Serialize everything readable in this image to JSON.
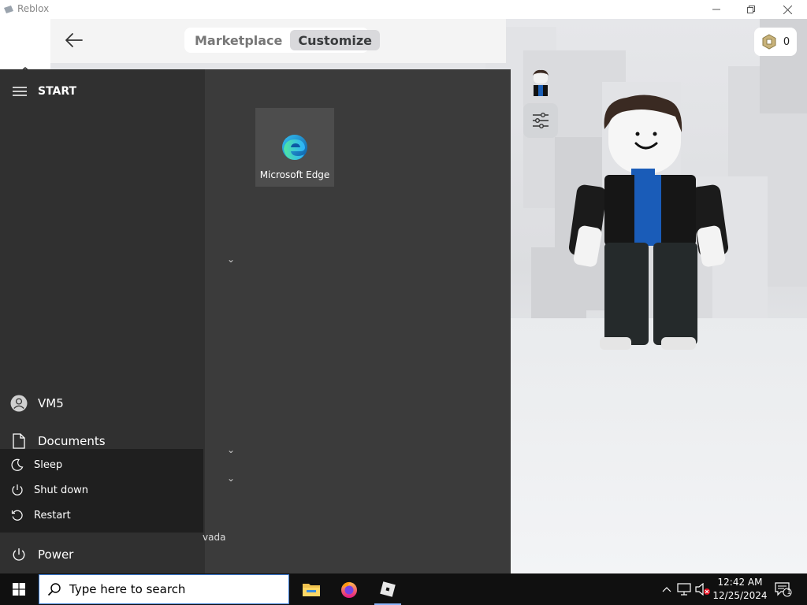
{
  "window": {
    "title": "Reblox"
  },
  "topbar": {
    "tabs": [
      {
        "label": "Marketplace",
        "active": false
      },
      {
        "label": "Customize",
        "active": true
      }
    ],
    "robux_count": "0"
  },
  "start_menu": {
    "header": "START",
    "side_items": [
      {
        "label": "VM5",
        "icon": "user-icon"
      },
      {
        "label": "Documents",
        "icon": "document-icon"
      }
    ],
    "power_options": [
      {
        "label": "Sleep",
        "icon": "moon-icon"
      },
      {
        "label": "Shut down",
        "icon": "power-icon"
      },
      {
        "label": "Restart",
        "icon": "restart-icon"
      }
    ],
    "power_label": "Power",
    "tile": {
      "label": "Microsoft Edge",
      "icon": "edge-icon"
    },
    "partial_text": "vada"
  },
  "taskbar": {
    "search_placeholder": "Type here to search",
    "apps": [
      "file-explorer-icon",
      "firefox-icon",
      "roblox-icon"
    ],
    "clock": {
      "time": "12:42 AM",
      "date": "12/25/2024"
    },
    "notification_count": "1"
  },
  "colors": {
    "start_bg": "#3b3b3b",
    "start_left_bg": "#303030",
    "taskbar_bg": "#101010",
    "search_border": "#3b7bd4",
    "accent": "#8ab4f8"
  }
}
